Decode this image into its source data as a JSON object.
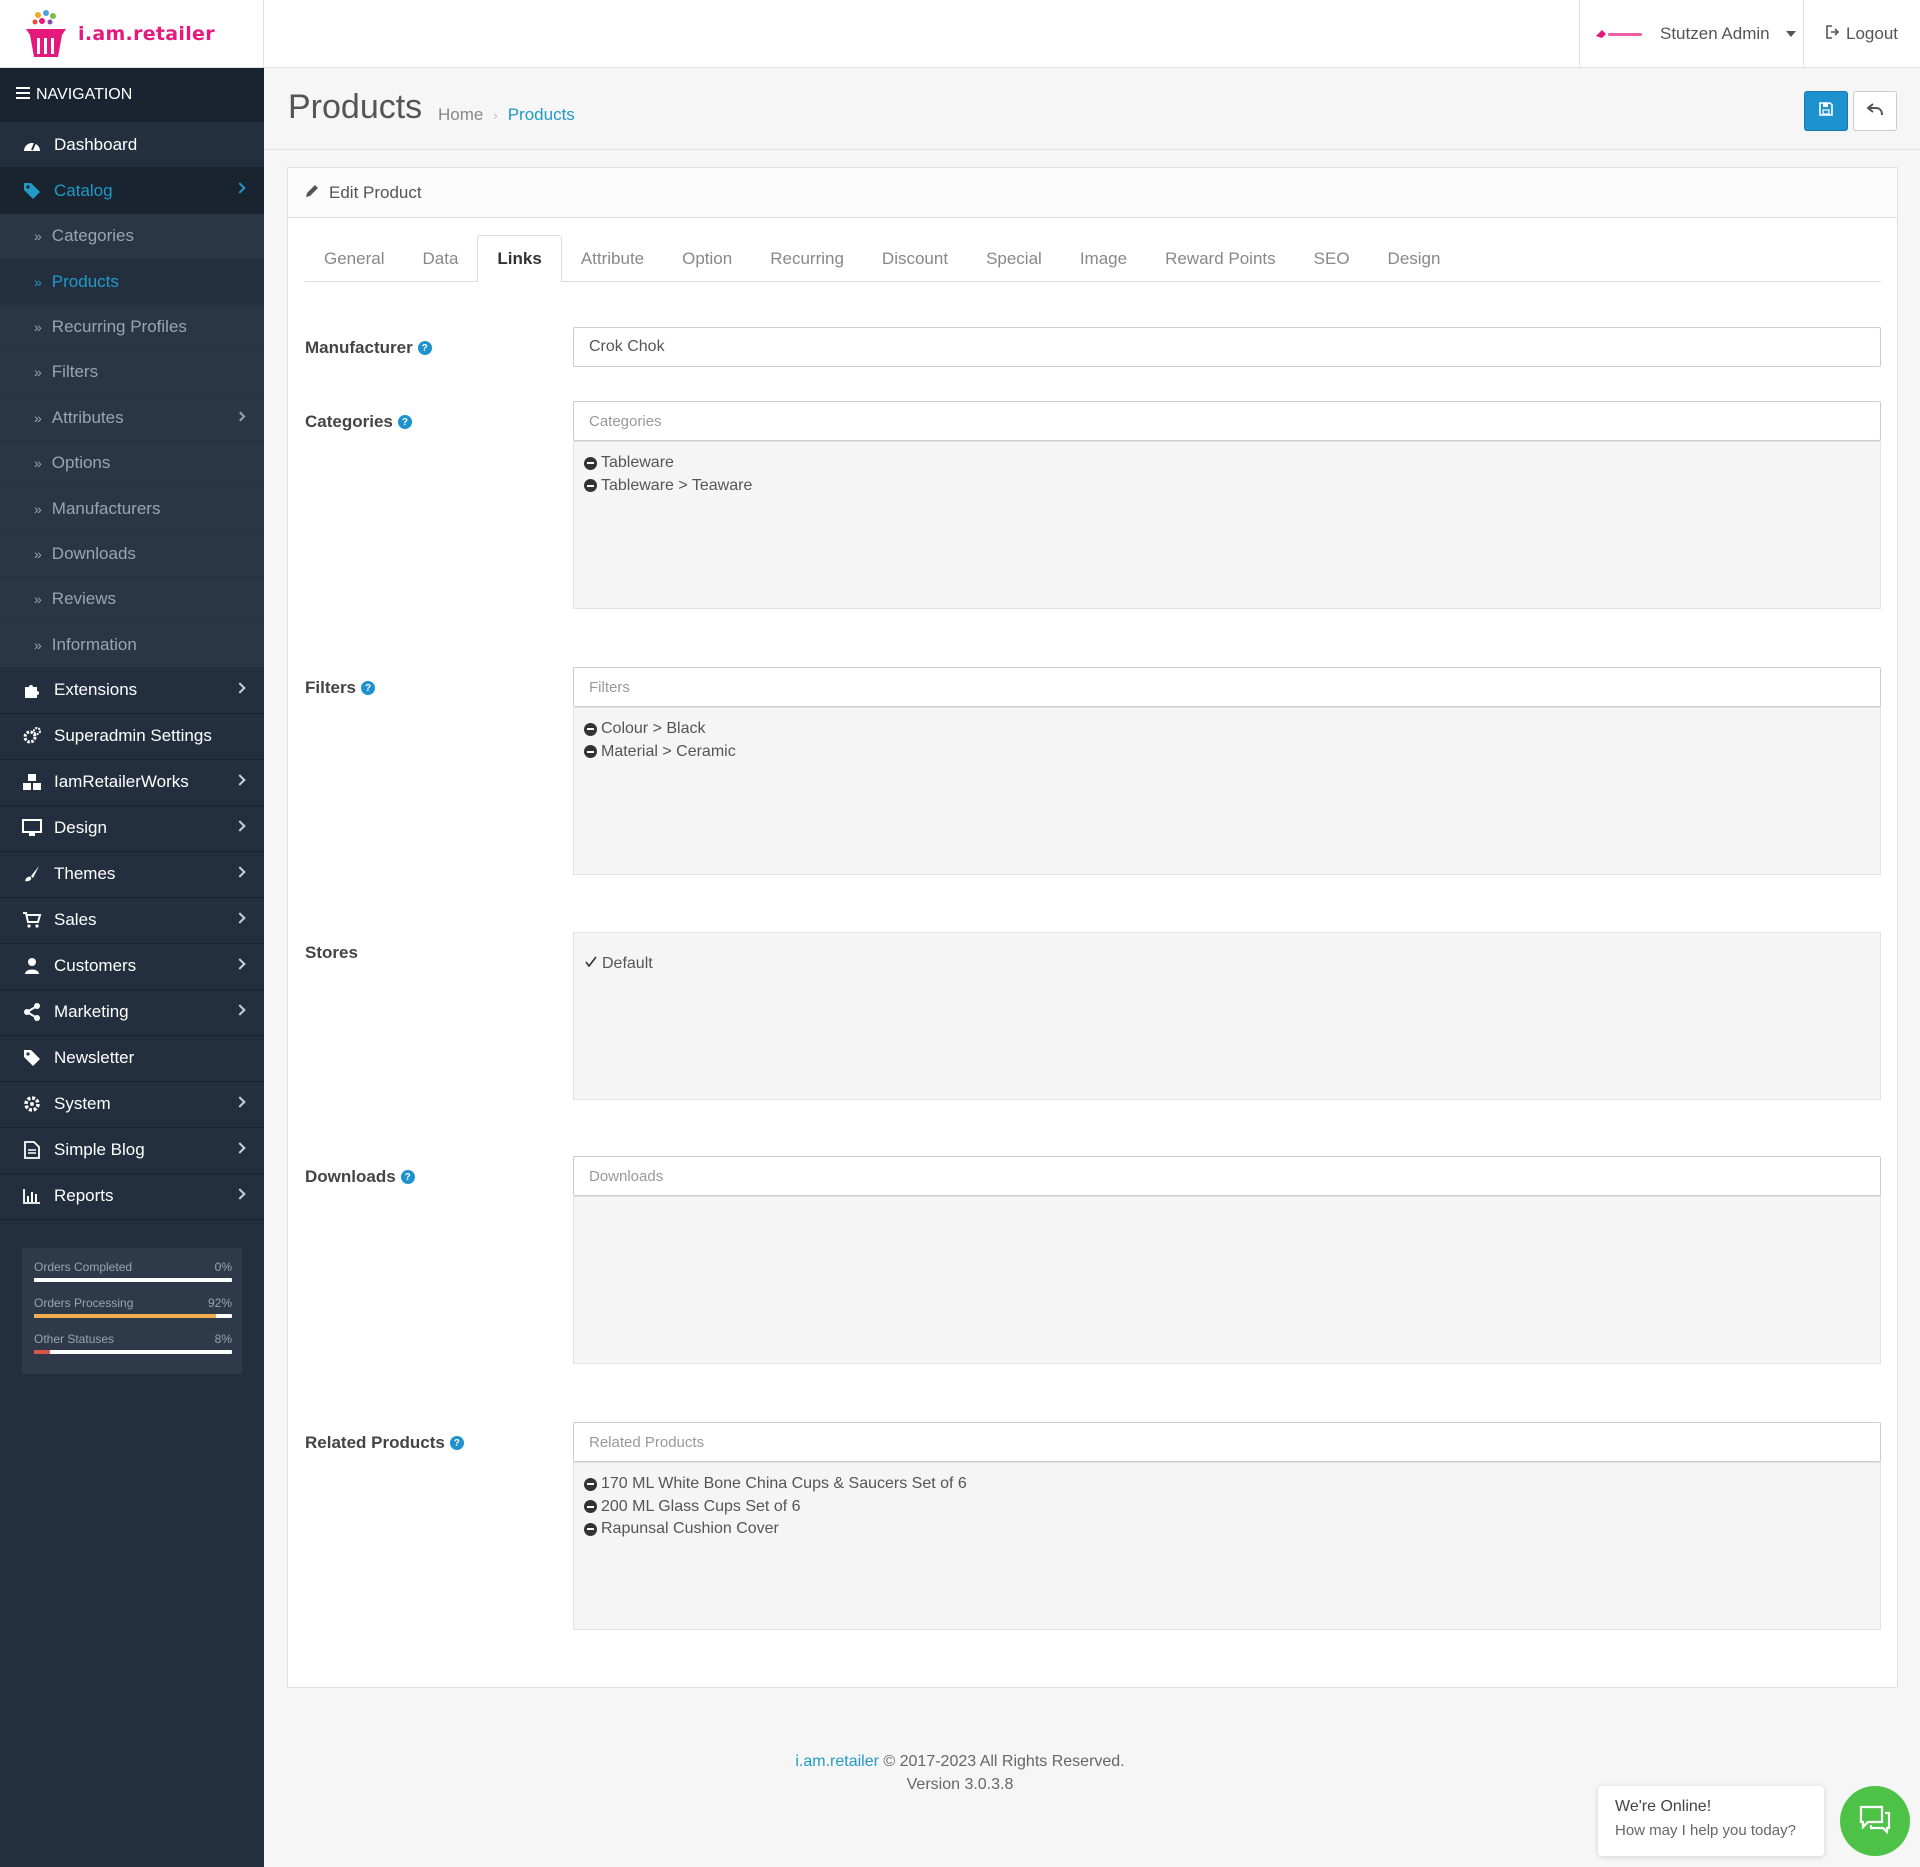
{
  "brand": {
    "name": "i.am.retailer"
  },
  "header": {
    "user_name": "Stutzen Admin",
    "logout_label": "Logout"
  },
  "sidebar": {
    "heading": "NAVIGATION",
    "items_top": [
      {
        "label": "Dashboard",
        "icon": "dashboard-icon"
      },
      {
        "label": "Catalog",
        "icon": "tags-icon"
      }
    ],
    "catalog_children": [
      {
        "label": "Categories"
      },
      {
        "label": "Products"
      },
      {
        "label": "Recurring Profiles"
      },
      {
        "label": "Filters"
      },
      {
        "label": "Attributes"
      },
      {
        "label": "Options"
      },
      {
        "label": "Manufacturers"
      },
      {
        "label": "Downloads"
      },
      {
        "label": "Reviews"
      },
      {
        "label": "Information"
      }
    ],
    "items_bottom": [
      {
        "label": "Extensions",
        "icon": "puzzle-icon"
      },
      {
        "label": "Superadmin Settings",
        "icon": "cogs-icon"
      },
      {
        "label": "IamRetailerWorks",
        "icon": "cubes-icon"
      },
      {
        "label": "Design",
        "icon": "desktop-icon"
      },
      {
        "label": "Themes",
        "icon": "paint-brush-icon"
      },
      {
        "label": "Sales",
        "icon": "cart-icon"
      },
      {
        "label": "Customers",
        "icon": "user-icon"
      },
      {
        "label": "Marketing",
        "icon": "share-icon"
      },
      {
        "label": "Newsletter",
        "icon": "tags-icon"
      },
      {
        "label": "System",
        "icon": "cog-icon"
      },
      {
        "label": "Simple Blog",
        "icon": "file-icon"
      },
      {
        "label": "Reports",
        "icon": "bar-chart-icon"
      }
    ],
    "stats": [
      {
        "label": "Orders Completed",
        "value": "0%",
        "fraction": 0.0,
        "color": "#ffffff"
      },
      {
        "label": "Orders Processing",
        "value": "92%",
        "fraction": 0.92,
        "color": "#f0ad4e"
      },
      {
        "label": "Other Statuses",
        "value": "8%",
        "fraction": 0.08,
        "color": "#d9534f"
      }
    ]
  },
  "page": {
    "title": "Products",
    "breadcrumb": {
      "home": "Home",
      "current": "Products"
    },
    "panel_title": "Edit Product",
    "tabs": [
      "General",
      "Data",
      "Links",
      "Attribute",
      "Option",
      "Recurring",
      "Discount",
      "Special",
      "Image",
      "Reward Points",
      "SEO",
      "Design"
    ],
    "active_tab": "Links"
  },
  "form": {
    "manufacturer": {
      "label": "Manufacturer",
      "value": "Crok Chok"
    },
    "categories": {
      "label": "Categories",
      "placeholder": "Categories",
      "items": [
        "Tableware",
        "Tableware > Teaware"
      ]
    },
    "filters": {
      "label": "Filters",
      "placeholder": "Filters",
      "items": [
        "Colour > Black",
        "Material > Ceramic"
      ]
    },
    "stores": {
      "label": "Stores",
      "items": [
        "Default"
      ]
    },
    "downloads": {
      "label": "Downloads",
      "placeholder": "Downloads",
      "items": []
    },
    "related": {
      "label": "Related Products",
      "placeholder": "Related Products",
      "items": [
        "170 ML White Bone China Cups & Saucers Set of 6",
        "200 ML Glass Cups Set of 6",
        "Rapunsal Cushion Cover"
      ]
    }
  },
  "footer": {
    "brand_link": "i.am.retailer",
    "copyright": " © 2017-2023 All Rights Reserved.",
    "version": "Version 3.0.3.8"
  },
  "chat": {
    "line1": "We're Online!",
    "line2": "How may I help you today?"
  },
  "colors": {
    "accent": "#229ac8",
    "brand": "#e5197d",
    "sidebar_bg": "#232f3e",
    "chat": "#4dc247"
  }
}
